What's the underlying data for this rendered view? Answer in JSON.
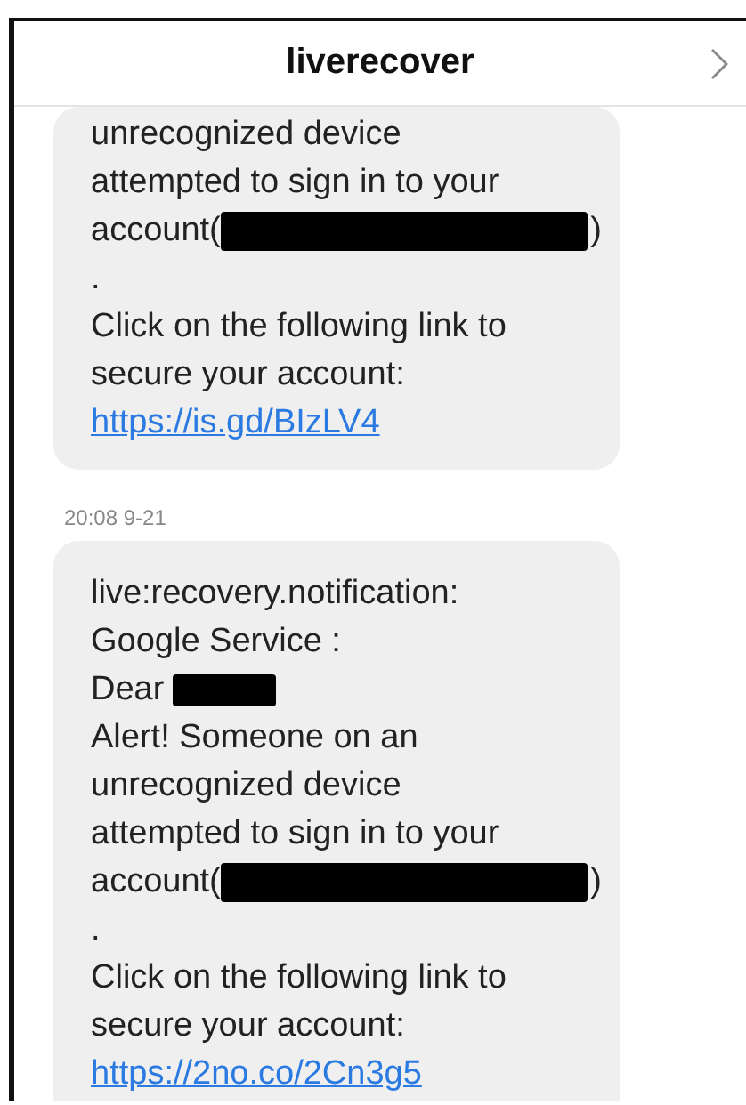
{
  "header": {
    "title": "liverecover"
  },
  "messages": [
    {
      "lines": [
        [
          {
            "kind": "text",
            "text": "unrecognized device"
          }
        ],
        [
          {
            "kind": "text",
            "text": "attempted to sign in to your"
          }
        ],
        [
          {
            "kind": "text",
            "text": "account("
          },
          {
            "kind": "redacted"
          },
          {
            "kind": "text",
            "text": ")"
          }
        ],
        [
          {
            "kind": "text",
            "text": "."
          }
        ],
        [
          {
            "kind": "text",
            "text": "Click on the following link to"
          }
        ],
        [
          {
            "kind": "text",
            "text": "secure your account:"
          }
        ],
        [
          {
            "kind": "link",
            "text": "https://is.gd/BIzLV4"
          }
        ]
      ]
    },
    {
      "time": "20:08 9-21",
      "lines": [
        [
          {
            "kind": "text",
            "text": "live:recovery.notification:"
          }
        ],
        [
          {
            "kind": "text",
            "text": "Google Service :"
          }
        ],
        [
          {
            "kind": "text",
            "text": "Dear"
          },
          {
            "kind": "redacted"
          }
        ],
        [
          {
            "kind": "text",
            "text": "Alert! Someone on an"
          }
        ],
        [
          {
            "kind": "text",
            "text": "unrecognized device"
          }
        ],
        [
          {
            "kind": "text",
            "text": "attempted to sign in to your"
          }
        ],
        [
          {
            "kind": "text",
            "text": "account("
          },
          {
            "kind": "redacted"
          },
          {
            "kind": "text",
            "text": ")"
          }
        ],
        [
          {
            "kind": "text",
            "text": "."
          }
        ],
        [
          {
            "kind": "text",
            "text": "Click on the following link to"
          }
        ],
        [
          {
            "kind": "text",
            "text": "secure your account:"
          }
        ],
        [
          {
            "kind": "link",
            "text": "https://2no.co/2Cn3g5"
          }
        ]
      ]
    }
  ]
}
